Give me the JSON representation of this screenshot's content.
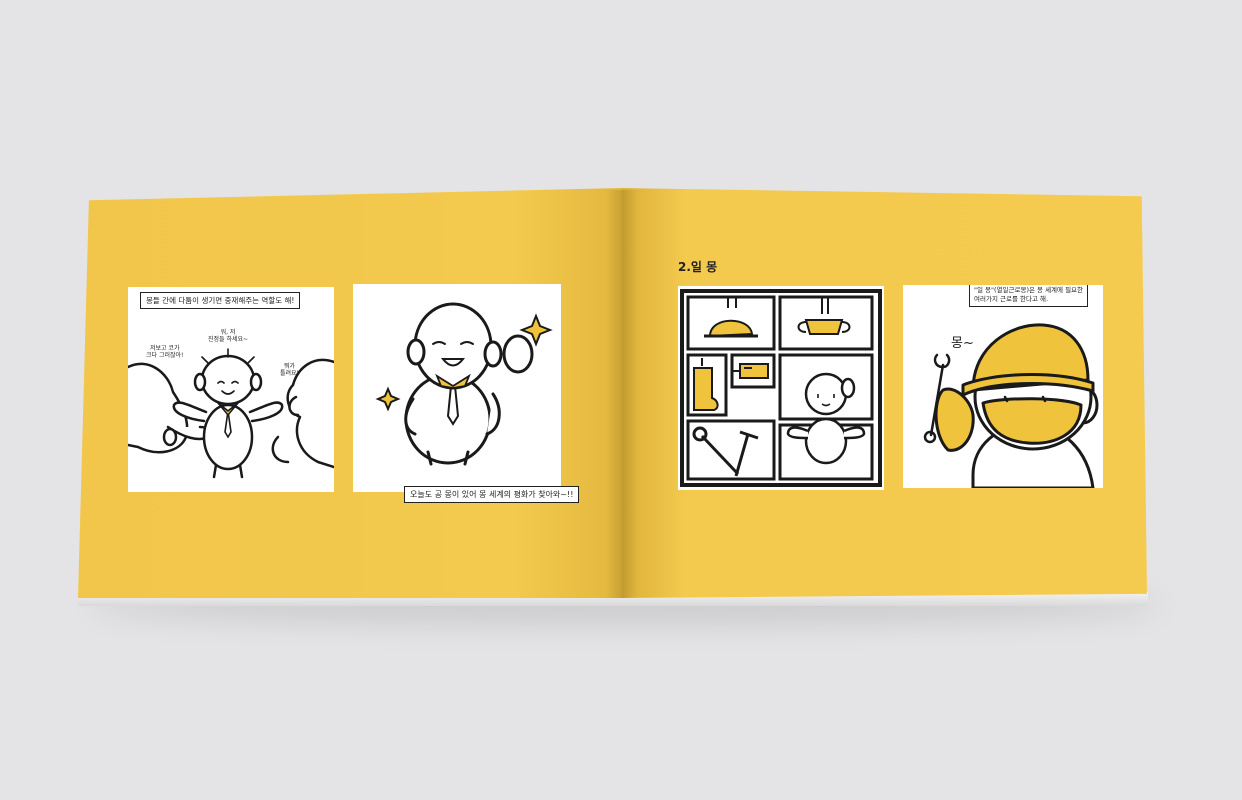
{
  "chapter_title": "2.일 몽",
  "captions": {
    "panel1_top": "몽들 간에 다툼이 생기면 중재해주는 역할도 해!",
    "panel1_center": "워, 저\n진정들 하세요~",
    "panel1_left": "저보고 코가\n크다 그러잖아!",
    "panel1_right": "뭐가\n틀려요!",
    "panel2_bottom": "오늘도 공 몽이 있어 몽 세계의 평화가 찾아와~!!",
    "panel4_top_line1": "\"일 몽\"(열일근로몽)은 몽 세계에 필요한",
    "panel4_top_line2": "여러가지 근로를 한다고 해.",
    "panel4_sound": "몽~"
  },
  "colors": {
    "page_yellow": "#f2c94c",
    "accent_yellow": "#f0c33c",
    "ink": "#1a1a1a",
    "background": "#e4e4e6"
  },
  "icons": [
    "sparkle-icon",
    "hard-hat-icon",
    "face-mask-icon",
    "safety-boot-icon",
    "injection-icon",
    "wrench-icon",
    "hammer-icon"
  ]
}
